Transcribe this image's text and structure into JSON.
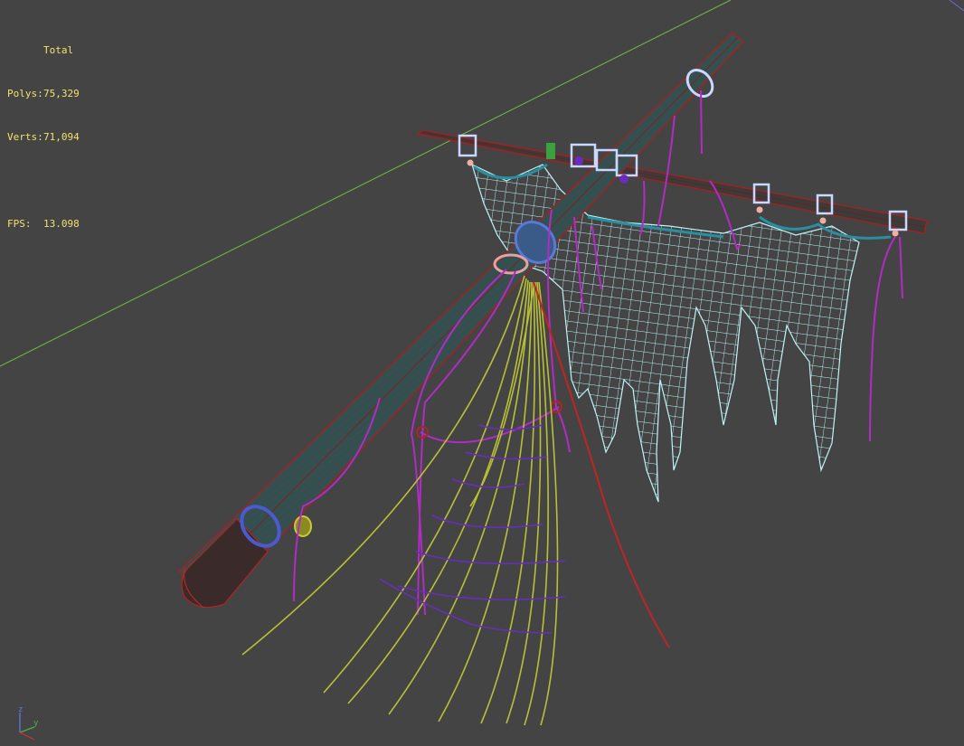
{
  "stats": {
    "header": "Total",
    "polys_label": "Polys:",
    "polys_value": "75,329",
    "verts_label": "Verts:",
    "verts_value": "71,094",
    "fps_label": "FPS:",
    "fps_value": "13.098"
  },
  "gizmo": {
    "z_label": "z",
    "y_label": "y"
  },
  "colors": {
    "background": "#444444",
    "stats_text": "#f2e26a",
    "grid_line": "#6fbf3a",
    "mast_wire": "#a81f1f",
    "mast_fill": "#2f5151",
    "net": "#bff4f8",
    "rope_magenta": "#b02cc2",
    "rope_yellow": "#b8c038",
    "rope_violet": "#6a2cc0",
    "rope_teal": "#2a8fa0",
    "ring_blue": "#5a78d8",
    "ring_lightblue": "#c8d8ff"
  }
}
